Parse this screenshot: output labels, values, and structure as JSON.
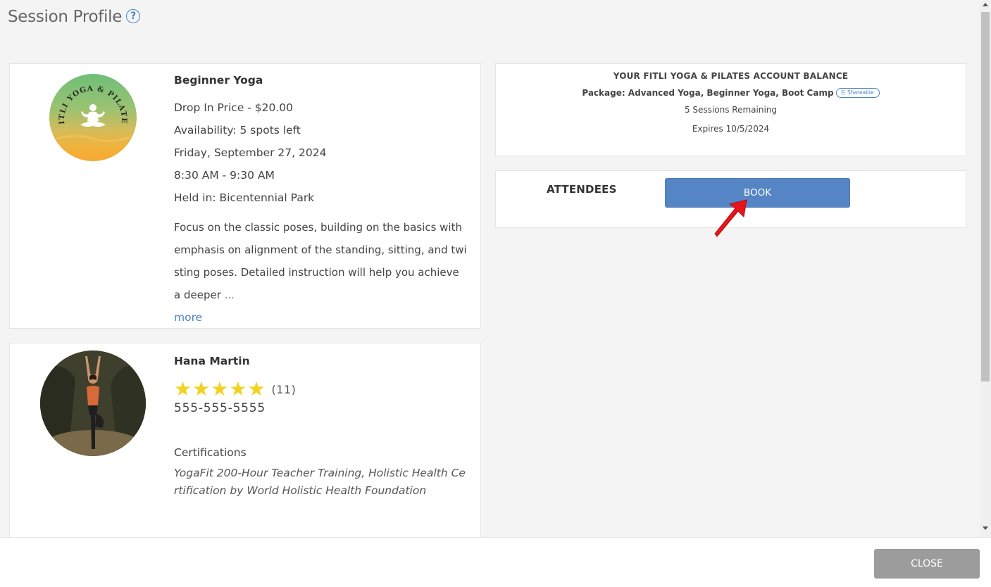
{
  "header": {
    "title": "Session Profile",
    "help_icon": "?"
  },
  "session": {
    "logo_text": "FITLI YOGA & PILATES",
    "name": "Beginner Yoga",
    "price": "Drop In Price - $20.00",
    "availability": "Availability: 5 spots left",
    "date": "Friday, September 27, 2024",
    "time": "8:30 AM - 9:30 AM",
    "location": "Held in: Bicentennial Park",
    "description": "Focus on the classic poses, building on the basics with emphasis on alignment of the standing, sitting, and twisting poses. Detailed instruction will help you achieve a deeper",
    "ellipsis": "...",
    "more_label": "more"
  },
  "instructor": {
    "name": "Hana Martin",
    "rating": 5,
    "rating_count": "(11)",
    "phone": "555-555-5555",
    "certifications_label": "Certifications",
    "certifications": "YogaFit 200-Hour Teacher Training, Holistic Health Certification by World Holistic Health Foundation"
  },
  "balance": {
    "title": "YOUR FITLI YOGA & PILATES ACCOUNT BALANCE",
    "package": "Package: Advanced Yoga, Beginner Yoga, Boot Camp",
    "shareable_badge": "Shareable",
    "sessions": "5 Sessions Remaining",
    "expires": "Expires 10/5/2024"
  },
  "attendees": {
    "label": "ATTENDEES",
    "book_label": "BOOK"
  },
  "footer": {
    "close_label": "CLOSE"
  },
  "colors": {
    "accent": "#5585c5",
    "link": "#4a86c5",
    "star": "#f2d21c",
    "close_button": "#9c9c9c"
  }
}
